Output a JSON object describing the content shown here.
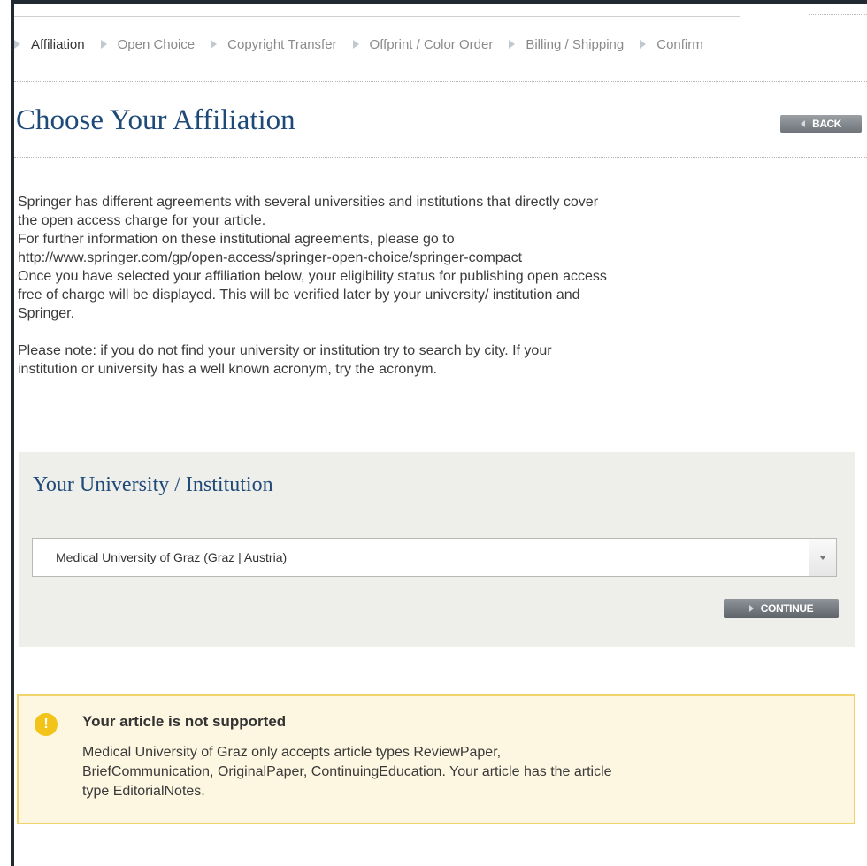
{
  "steps": [
    {
      "label": "Affiliation",
      "active": true
    },
    {
      "label": "Open Choice",
      "active": false
    },
    {
      "label": "Copyright Transfer",
      "active": false
    },
    {
      "label": "Offprint / Color Order",
      "active": false
    },
    {
      "label": "Billing / Shipping",
      "active": false
    },
    {
      "label": "Confirm",
      "active": false
    }
  ],
  "page": {
    "title": "Choose Your Affiliation",
    "back_label": "BACK"
  },
  "intro": {
    "line1": "Springer has different agreements with several universities and institutions that directly cover",
    "line2": "the open access charge for your article.",
    "line3": "For further information on these institutional agreements, please go to",
    "line4": "http://www.springer.com/gp/open-access/springer-open-choice/springer-compact",
    "line5": "Once you have selected your affiliation below, your eligibility status for publishing open access",
    "line6": "free of charge will be displayed. This will be verified later by your university/ institution and",
    "line7": "Springer.",
    "note1": "Please note: if you do not find your university or institution try to search by city. If your",
    "note2": "institution or university has a well known acronym, try the acronym."
  },
  "affiliation": {
    "title": "Your University / Institution",
    "selected_value": "Medical University of Graz (Graz | Austria)",
    "continue_label": "CONTINUE"
  },
  "alert": {
    "icon": "exclamation-icon",
    "title": "Your article is not supported",
    "body1": "Medical University of Graz only accepts article types ReviewPaper,",
    "body2": "BriefCommunication, OriginalPaper, ContinuingEducation. Your article has the article",
    "body3": "type EditorialNotes.",
    "accent": "#f2c318"
  },
  "colors": {
    "title_blue": "#1f4a78",
    "panel_bg": "#eeeeea",
    "alert_bg": "#fdf7e1",
    "alert_border": "#f2d36b"
  }
}
